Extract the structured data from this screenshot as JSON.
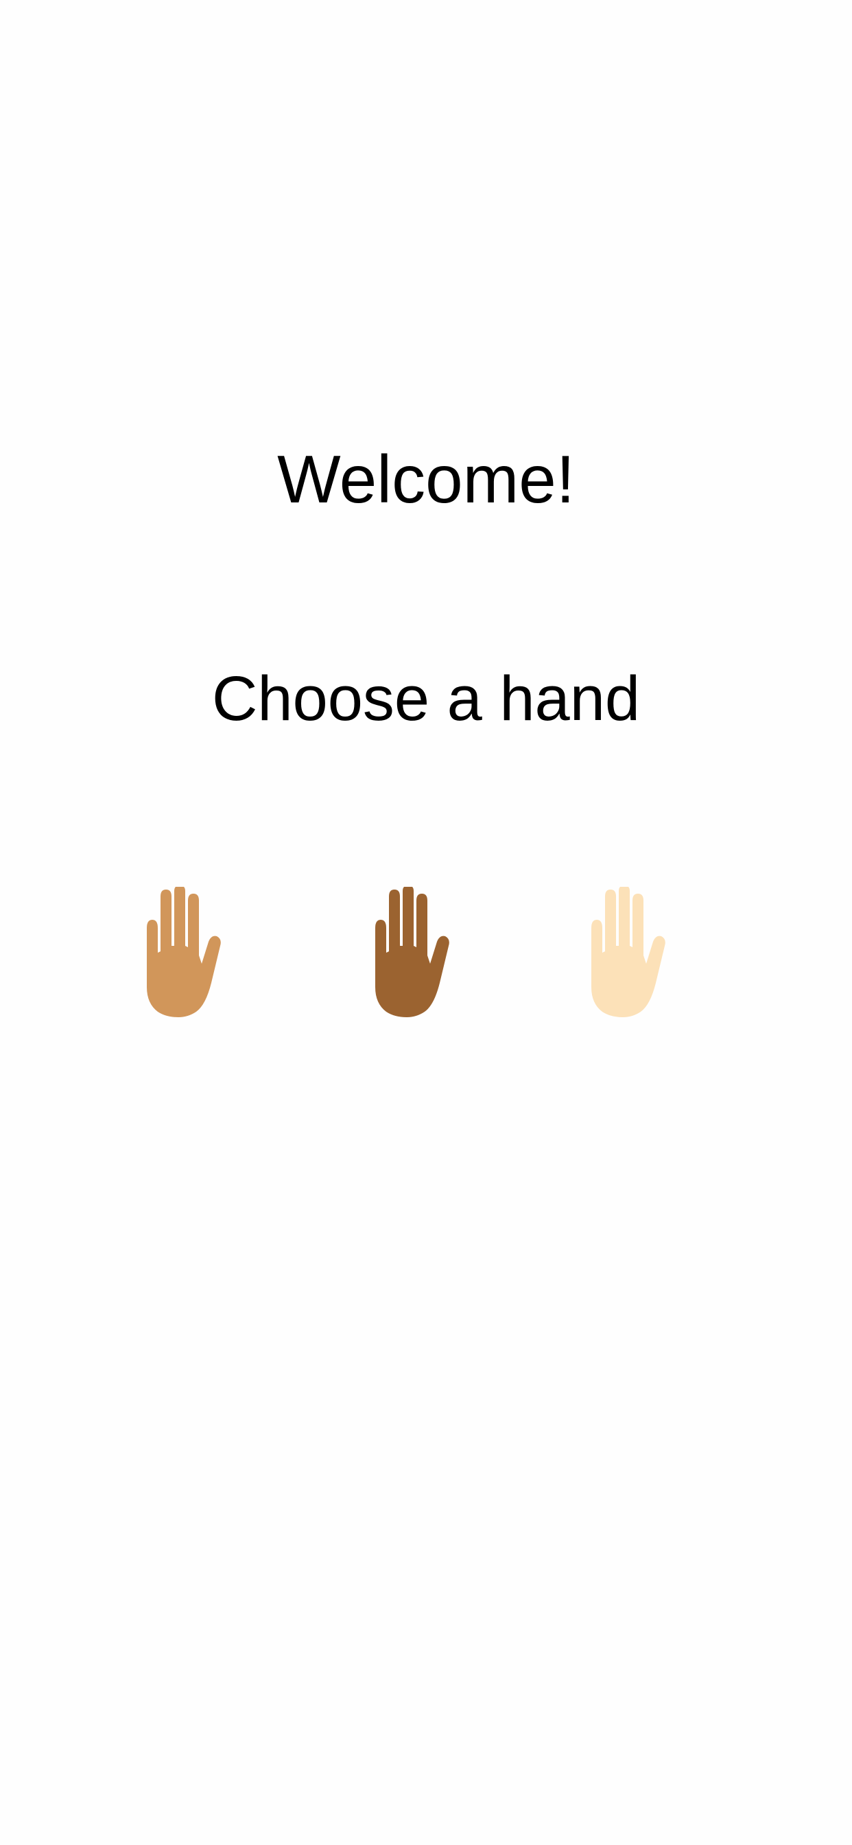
{
  "welcome": {
    "title": "Welcome!"
  },
  "prompt": {
    "text": "Choose a hand"
  },
  "hands": [
    {
      "name": "hand-medium",
      "color": "#D1965A",
      "icon": "raised-hand-icon"
    },
    {
      "name": "hand-dark",
      "color": "#9B6330",
      "icon": "raised-hand-icon"
    },
    {
      "name": "hand-light",
      "color": "#FCE1B8",
      "icon": "raised-hand-icon"
    }
  ]
}
